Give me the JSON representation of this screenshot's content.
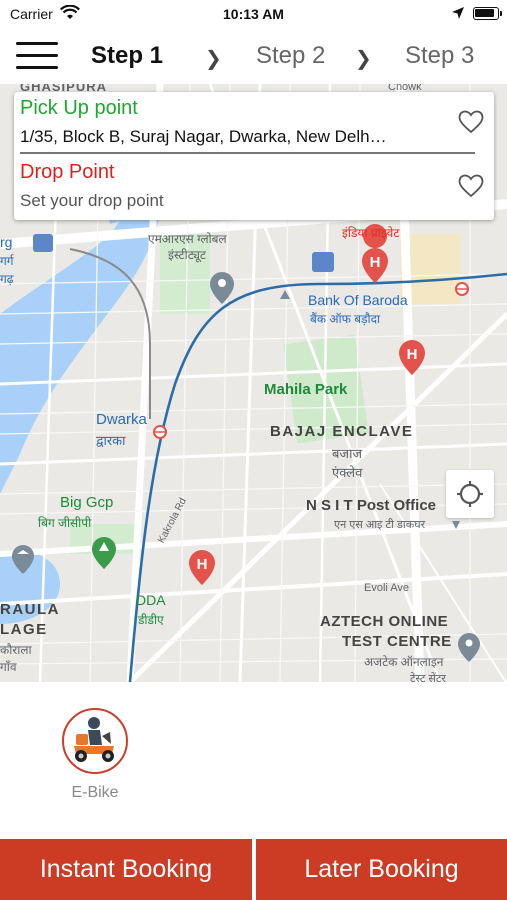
{
  "status_bar": {
    "carrier": "Carrier",
    "time": "10:13 AM"
  },
  "steps": {
    "step1": "Step 1",
    "step2": "Step 2",
    "step3": "Step 3"
  },
  "address": {
    "pickup_label": "Pick Up point",
    "pickup_value": "1/35, Block B, Suraj Nagar, Dwarka, New Delh…",
    "drop_label": "Drop Point",
    "drop_placeholder": "Set your drop point"
  },
  "map": {
    "labels": {
      "ghasipura": "GHASIPURA",
      "chowk": "Chowk",
      "india_private": "इंडिया प्राइवेट",
      "mr_global": "एमआरएस ग्लोबल",
      "institute": "इंस्टीट्यूट",
      "bank_of_baroda": "Bank Of Baroda",
      "bank_of_baroda_hi": "बैंक ऑफ बड़ौदा",
      "mahila_park": "Mahila Park",
      "bajaj_enclave": "BAJAJ ENCLAVE",
      "bajaj_hi": "बजाज",
      "enclave_hi": "एंक्लेव",
      "dwarka": "Dwarka",
      "dwarka_hi": "द्वारका",
      "nsit": "N S I T Post Office",
      "nsit_hi": "एन एस आइ टी डाकघर",
      "big_gcp": "Big Gcp",
      "big_gcp_hi": "बिग जीसीपी",
      "kakrola_rd": "Kakrola Rd",
      "evoli_ave": "Evoli Ave",
      "dda": "DDA",
      "dda_hi": "डीडीए",
      "aztech": "AZTECH ONLINE",
      "test_centre": "TEST CENTRE",
      "aztech_hi": "अजटेक ऑनलाइन",
      "test_centre_hi": "टेस्ट सेंटर",
      "raula": "RAULA",
      "lage": "LAGE",
      "kaurala_hi": "कौराला",
      "gaon_hi": "गाँव",
      "org": "rg",
      "org_hi": "गर्ग",
      "left_hi": "गढ़"
    },
    "colors": {
      "water": "#a8d0f8",
      "park": "#c6e8c3",
      "metro_line": "#2b6da8",
      "road": "#ffffff",
      "hospital": "#e4534b"
    }
  },
  "vehicle": {
    "label": "E-Bike"
  },
  "buttons": {
    "instant": "Instant Booking",
    "later": "Later Booking"
  },
  "theme": {
    "accent": "#cc3b23",
    "pickup_color": "#1fa82f",
    "drop_color": "#e0201e"
  }
}
